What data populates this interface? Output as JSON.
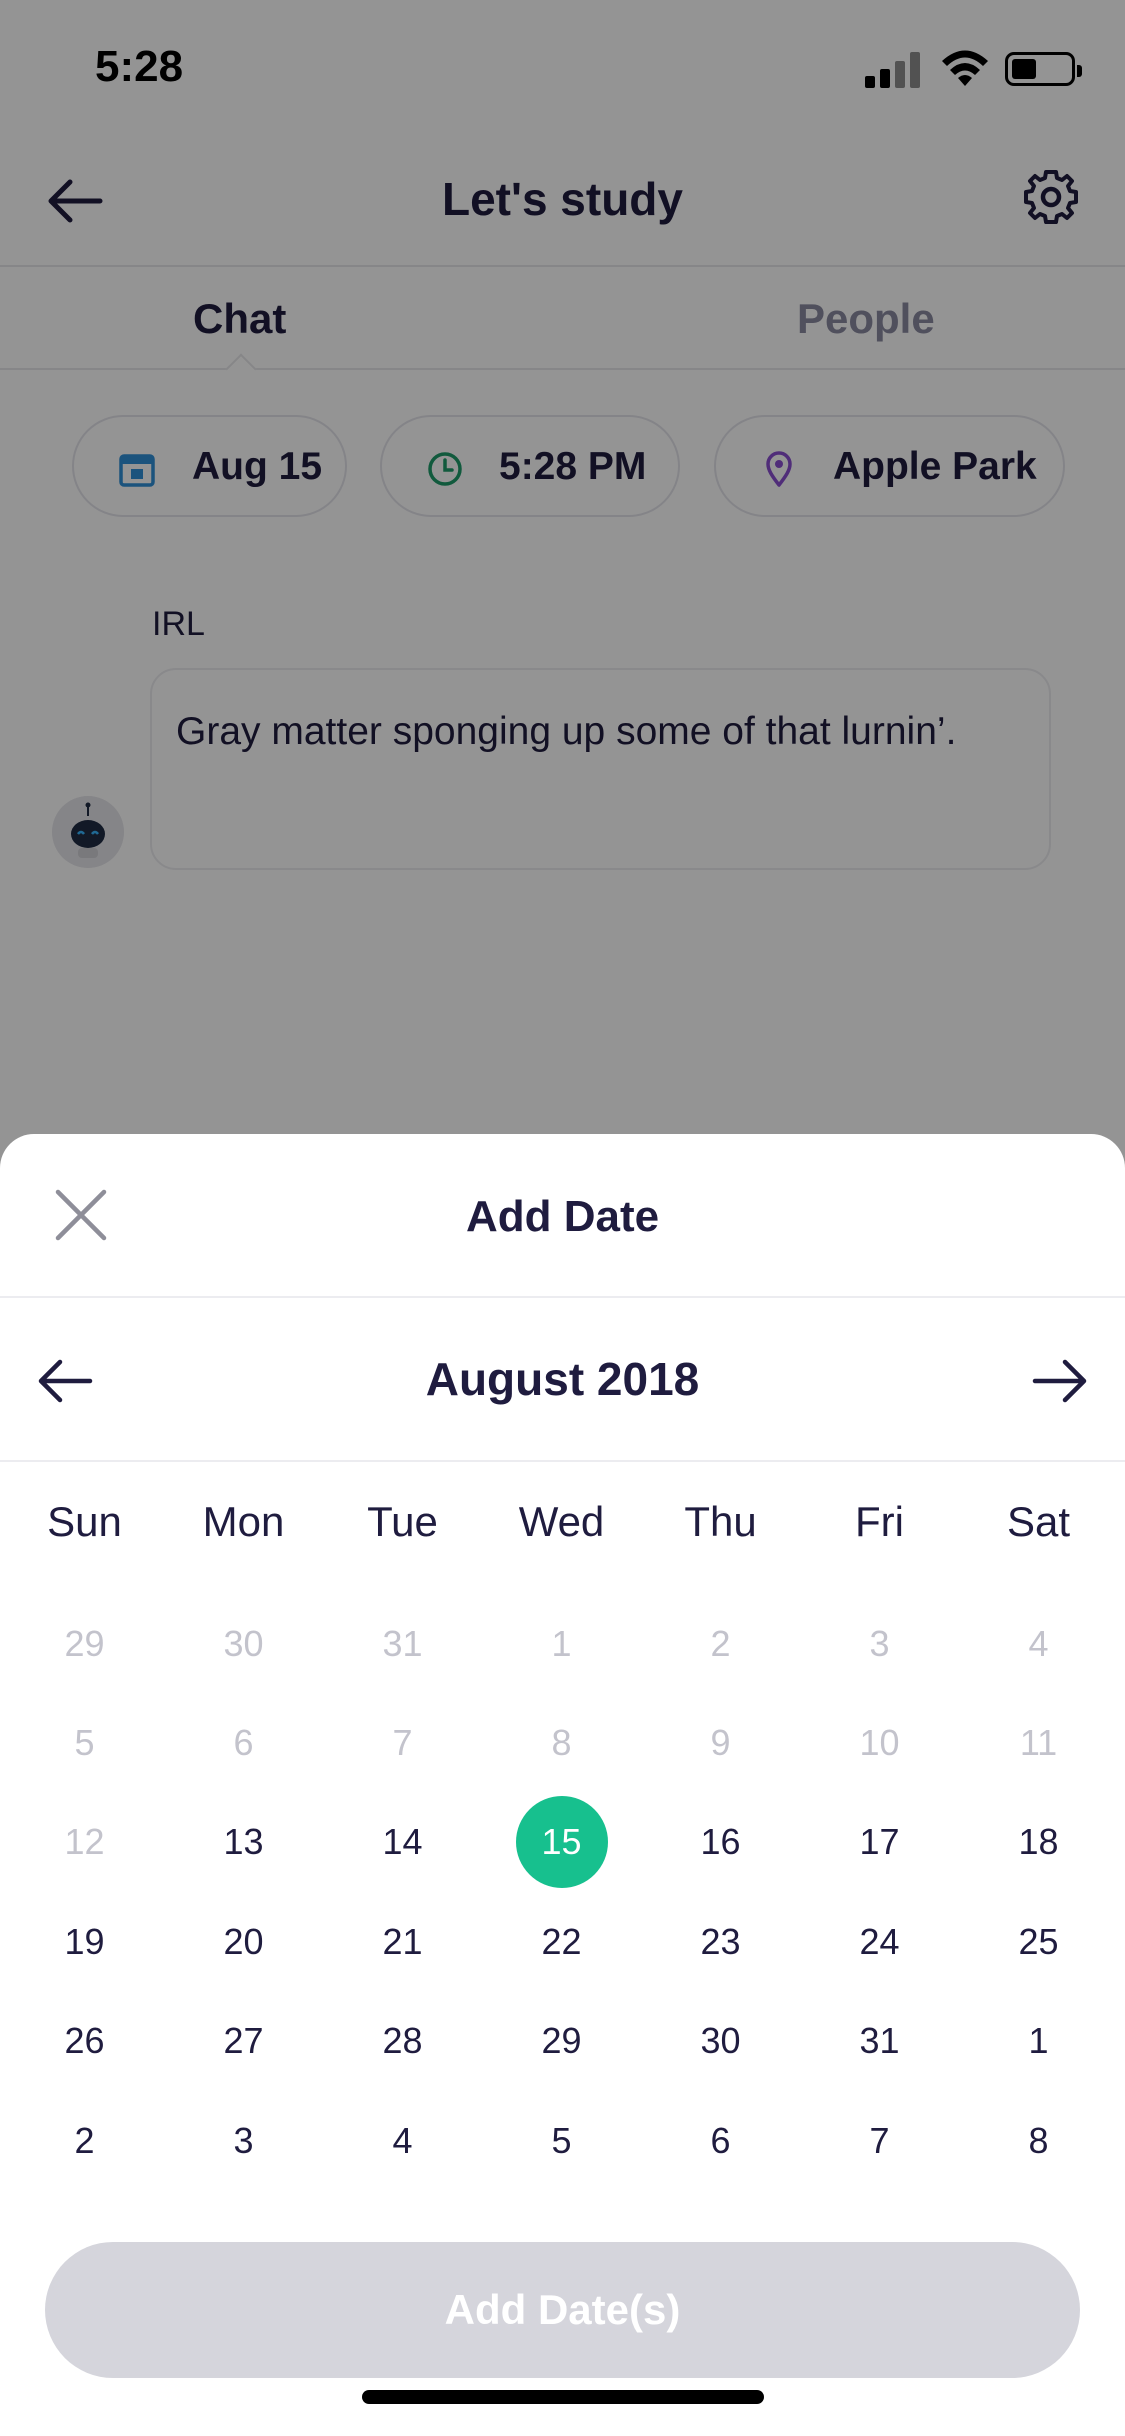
{
  "status_bar": {
    "time": "5:28"
  },
  "nav": {
    "title": "Let's study",
    "back_icon": "arrow-left-icon",
    "settings_icon": "gear-icon"
  },
  "tabs": [
    {
      "label": "Chat",
      "active": true
    },
    {
      "label": "People",
      "active": false
    }
  ],
  "chips": {
    "date": {
      "label": "Aug 15",
      "icon": "calendar-icon",
      "color": "#2f8fd8"
    },
    "time": {
      "label": "5:28 PM",
      "icon": "clock-icon",
      "color": "#1e9b6a"
    },
    "place": {
      "label": "Apple Park",
      "icon": "location-pin-icon",
      "color": "#8a4fd1"
    }
  },
  "message": {
    "sender": "IRL",
    "text": "Gray matter sponging up some of that lurnin’."
  },
  "sheet": {
    "title": "Add Date",
    "month_title": "August 2018",
    "weekdays": [
      "Sun",
      "Mon",
      "Tue",
      "Wed",
      "Thu",
      "Fri",
      "Sat"
    ],
    "weeks": [
      [
        {
          "d": "29",
          "muted": true
        },
        {
          "d": "30",
          "muted": true
        },
        {
          "d": "31",
          "muted": true
        },
        {
          "d": "1",
          "muted": true
        },
        {
          "d": "2",
          "muted": true
        },
        {
          "d": "3",
          "muted": true
        },
        {
          "d": "4",
          "muted": true
        }
      ],
      [
        {
          "d": "5",
          "muted": true
        },
        {
          "d": "6",
          "muted": true
        },
        {
          "d": "7",
          "muted": true
        },
        {
          "d": "8",
          "muted": true
        },
        {
          "d": "9",
          "muted": true
        },
        {
          "d": "10",
          "muted": true
        },
        {
          "d": "11",
          "muted": true
        }
      ],
      [
        {
          "d": "12",
          "muted": true
        },
        {
          "d": "13"
        },
        {
          "d": "14"
        },
        {
          "d": "15",
          "selected": true
        },
        {
          "d": "16"
        },
        {
          "d": "17"
        },
        {
          "d": "18"
        }
      ],
      [
        {
          "d": "19"
        },
        {
          "d": "20"
        },
        {
          "d": "21"
        },
        {
          "d": "22"
        },
        {
          "d": "23"
        },
        {
          "d": "24"
        },
        {
          "d": "25"
        }
      ],
      [
        {
          "d": "26"
        },
        {
          "d": "27"
        },
        {
          "d": "28"
        },
        {
          "d": "29"
        },
        {
          "d": "30"
        },
        {
          "d": "31"
        },
        {
          "d": "1"
        }
      ],
      [
        {
          "d": "2"
        },
        {
          "d": "3"
        },
        {
          "d": "4"
        },
        {
          "d": "5"
        },
        {
          "d": "6"
        },
        {
          "d": "7"
        },
        {
          "d": "8"
        }
      ]
    ],
    "add_button_label": "Add Date(s)",
    "accent_color": "#17c08e"
  }
}
